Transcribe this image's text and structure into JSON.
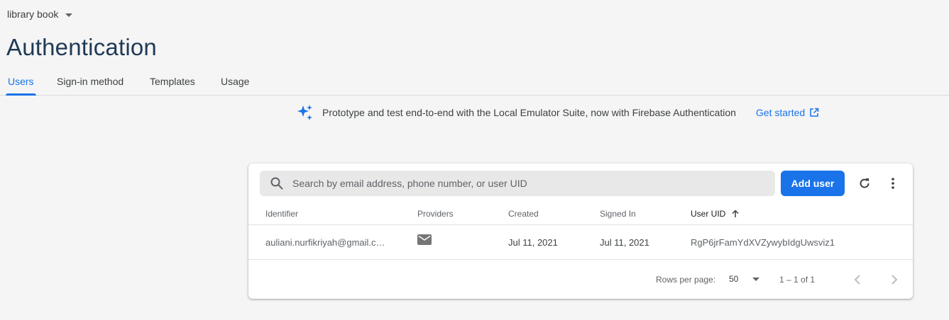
{
  "project": {
    "name": "library book"
  },
  "page": {
    "title": "Authentication"
  },
  "tabs": [
    {
      "label": "Users",
      "active": true
    },
    {
      "label": "Sign-in method",
      "active": false
    },
    {
      "label": "Templates",
      "active": false
    },
    {
      "label": "Usage",
      "active": false
    }
  ],
  "banner": {
    "icon": "sparkle-icon",
    "text": "Prototype and test end-to-end with the Local Emulator Suite, now with Firebase Authentication",
    "link_label": "Get started",
    "link_icon": "open-in-new-icon"
  },
  "users_table": {
    "search_placeholder": "Search by email address, phone number, or user UID",
    "add_user_label": "Add user",
    "columns": [
      "Identifier",
      "Providers",
      "Created",
      "Signed In",
      "User UID"
    ],
    "sorted_column": "User UID",
    "rows": [
      {
        "identifier": "auliani.nurfikriyah@gmail.c…",
        "provider_icon": "email-icon",
        "created": "Jul 11, 2021",
        "signed_in": "Jul 11, 2021",
        "uid": "RgP6jrFamYdXVZywybIdgUwsviz1"
      }
    ],
    "footer": {
      "rows_per_page_label": "Rows per page:",
      "rows_per_page_value": "50",
      "range": "1 – 1 of 1"
    }
  },
  "colors": {
    "accent": "#1a73e8",
    "title": "#1f3a57",
    "background": "#f5f5f5"
  }
}
